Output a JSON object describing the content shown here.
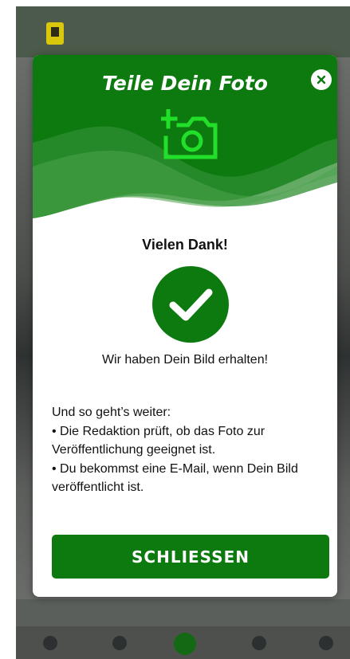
{
  "dialog": {
    "title": "Teile Dein Foto",
    "close_icon": "close-icon",
    "header_icon": "add-photo-icon",
    "success_icon": "check-circle-icon",
    "heading": "Vielen Dank!",
    "message": "Wir haben Dein Bild erhalten!",
    "next_steps": {
      "intro": "Und so geht’s weiter:",
      "items": [
        "• Die Redaktion prüft, ob das Foto zur Veröffentlichung geeignet ist.",
        "• Du bekommst eine E-Mail, wenn Dein Bild veröffentlicht ist."
      ]
    },
    "close_button_label": "SCHLIESSEN"
  },
  "colors": {
    "brand_green": "#0d7a10",
    "icon_green": "#22e02a",
    "dim_overlay": "#5b5f5b"
  }
}
